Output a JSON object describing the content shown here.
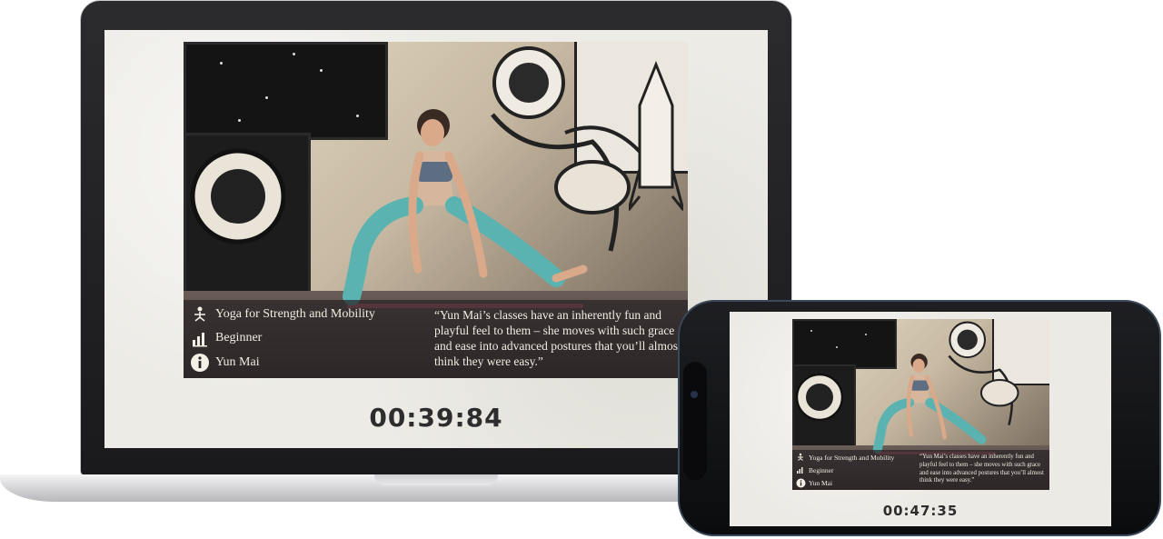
{
  "laptop": {
    "class_title": "Yoga for Strength and Mobility",
    "level": "Beginner",
    "instructor": "Yun Mai",
    "quote": "“Yun Mai’s classes have an inherently fun and playful feel to them – she moves with such grace and ease into advanced postures that you’ll almost think they were easy.”",
    "timer": "00:39:84"
  },
  "phone": {
    "class_title": "Yoga for Strength and Mobility",
    "level": "Beginner",
    "instructor": "Yun Mai",
    "quote": "“Yun Mai’s classes have an inherently fun and playful feel to them – she moves with such grace and ease into advanced postures that you’ll almost think they were easy.”",
    "timer": "00:47:35"
  },
  "icons": {
    "class": "yoga-pose-icon",
    "level": "signal-bars-icon",
    "instructor": "info-icon"
  },
  "colors": {
    "caption_bg": "#28222480",
    "caption_text": "#f2ece3",
    "timer_text": "#2d2d2d",
    "mat": "#c8667a",
    "leggings": "#5ab3b0"
  }
}
